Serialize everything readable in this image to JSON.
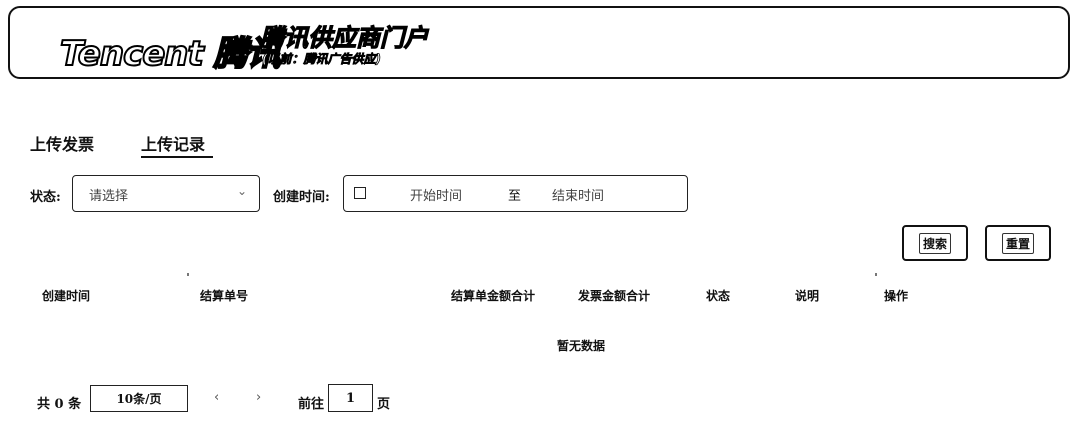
{
  "header": {
    "brand": "Tencent 腾讯",
    "portal_title": "腾讯供应商门户",
    "portal_subtitle": "(以前：腾讯广告供应)"
  },
  "tabs": [
    {
      "label": "上传发票",
      "active": false
    },
    {
      "label": "上传记录",
      "active": true
    }
  ],
  "filters": {
    "status_label": "状态:",
    "status_placeholder": "请选择",
    "created_time_label": "创建时间:",
    "start_placeholder": "开始时间",
    "range_separator": "至",
    "end_placeholder": "结束时间"
  },
  "actions": {
    "search_label": "搜索",
    "reset_label": "重置"
  },
  "table": {
    "columns": [
      "创建时间",
      "结算单号",
      "结算单金额合计",
      "发票金额合计",
      "状态",
      "说明",
      "操作"
    ],
    "empty_text": "暂无数据"
  },
  "pagination": {
    "total": "共 0 条",
    "page_size": "10条/页",
    "prev": "‹",
    "next": "›",
    "goto_label": "前往",
    "goto_value": "1",
    "page_suffix": "页"
  }
}
